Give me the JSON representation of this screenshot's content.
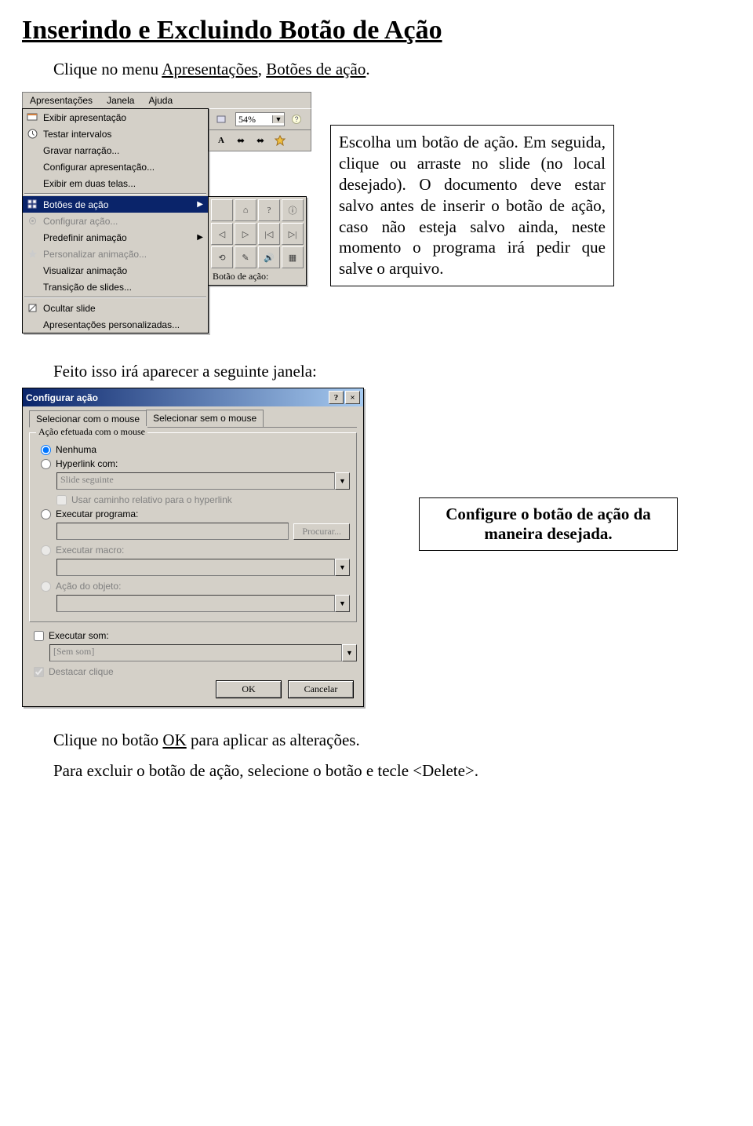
{
  "doc": {
    "title": "Inserindo e Excluindo Botão de Ação",
    "intro_pre": "Clique no menu ",
    "intro_link1": "Apresentações",
    "intro_sep": ", ",
    "intro_link2": "Botões de ação",
    "intro_post": ".",
    "info1": "Escolha um botão de ação. Em seguida, clique ou arraste no slide (no local desejado).\nO documento deve estar salvo antes de inserir o botão de ação, caso não esteja salvo ainda, neste momento o programa irá pedir que salve o arquivo.",
    "para2": "Feito isso irá aparecer a seguinte janela:",
    "info2": "Configure o botão de ação da maneira desejada.",
    "footer1_pre": "Clique no botão ",
    "footer1_link": "OK",
    "footer1_post": " para aplicar as alterações.",
    "footer2": "Para excluir o botão de ação, selecione o botão e tecle <Delete>."
  },
  "menubar": {
    "items": [
      "Apresentações",
      "Janela",
      "Ajuda"
    ]
  },
  "toolbar": {
    "zoom": "54%"
  },
  "menu": {
    "items": [
      {
        "icon": "slideshow",
        "label": "Exibir apresentação"
      },
      {
        "icon": "clock",
        "label": "Testar intervalos"
      },
      {
        "icon": "",
        "label": "Gravar narração..."
      },
      {
        "icon": "",
        "label": "Configurar apresentação..."
      },
      {
        "icon": "",
        "label": "Exibir em duas telas..."
      },
      {
        "div": true
      },
      {
        "icon": "grid",
        "label": "Botões de ação",
        "sub": true,
        "selected": true
      },
      {
        "icon": "gear",
        "label": "Configurar ação...",
        "disabled": true
      },
      {
        "icon": "",
        "label": "Predefinir animação",
        "sub": true
      },
      {
        "icon": "star",
        "label": "Personalizar animação...",
        "disabled": true
      },
      {
        "icon": "",
        "label": "Visualizar animação"
      },
      {
        "icon": "",
        "label": "Transição de slides..."
      },
      {
        "div": true
      },
      {
        "icon": "hide",
        "label": "Ocultar slide"
      },
      {
        "icon": "",
        "label": "Apresentações personalizadas..."
      }
    ],
    "popup_caption": "Botão de ação:",
    "popup_glyphs": [
      "",
      "⌂",
      "?",
      "ⓘ",
      "◁",
      "▷",
      "|◁",
      "▷|",
      "⟲",
      "✎",
      "🔊",
      "▦"
    ]
  },
  "dialog": {
    "title": "Configurar ação",
    "tabs": [
      "Selecionar com o mouse",
      "Selecionar sem o mouse"
    ],
    "group_title": "Ação efetuada com o mouse",
    "opt_none": "Nenhuma",
    "opt_hyperlink": "Hyperlink com:",
    "hyperlink_value": "Slide seguinte",
    "chk_relpath": "Usar caminho relativo para o hyperlink",
    "opt_run": "Executar programa:",
    "run_value": "",
    "btn_browse": "Procurar...",
    "opt_macro": "Executar macro:",
    "macro_value": "",
    "opt_obj": "Ação do objeto:",
    "obj_value": "",
    "chk_sound": "Executar som:",
    "sound_value": "[Sem som]",
    "chk_highlight": "Destacar clique",
    "btn_ok": "OK",
    "btn_cancel": "Cancelar"
  }
}
